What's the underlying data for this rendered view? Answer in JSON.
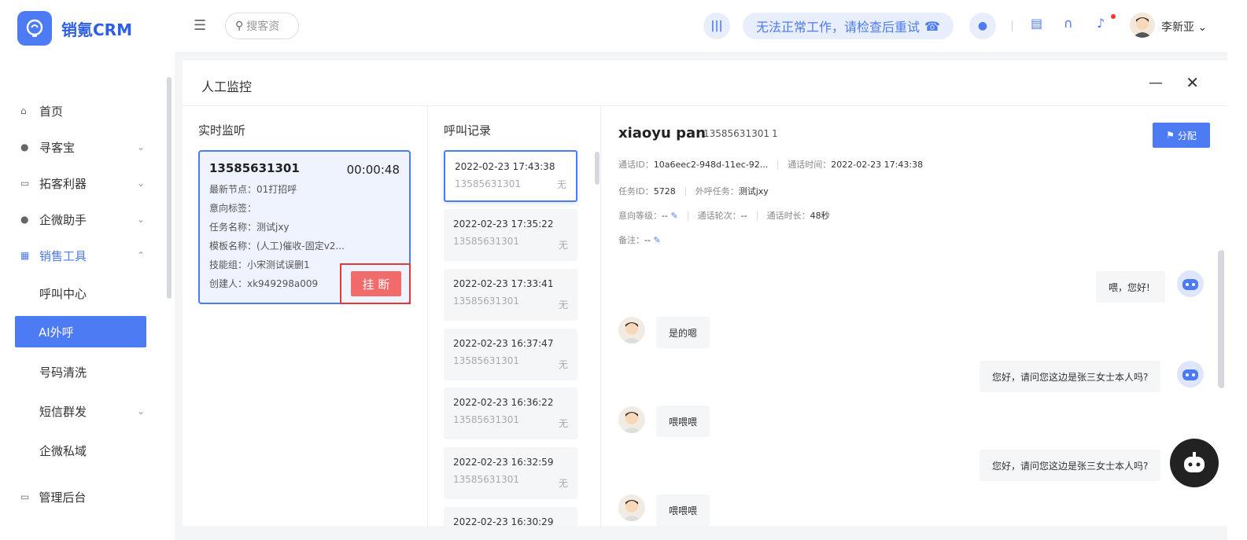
{
  "app": {
    "name": "销氪CRM"
  },
  "sidebar": {
    "items": [
      {
        "label": "首页"
      },
      {
        "label": "寻客宝"
      },
      {
        "label": "拓客利器"
      },
      {
        "label": "企微助手"
      },
      {
        "label": "销售工具"
      }
    ],
    "sub_items": [
      {
        "label": "呼叫中心"
      },
      {
        "label": "AI外呼"
      },
      {
        "label": "号码清洗"
      },
      {
        "label": "短信群发"
      },
      {
        "label": "企微私域"
      }
    ],
    "bottom": {
      "label": "管理后台"
    }
  },
  "topbar": {
    "search_placeholder": "搜客资",
    "status_text": "无法正常工作，请检查后重试",
    "user_name": "李新亚"
  },
  "panel": {
    "title": "人工监控",
    "live": {
      "title": "实时监听",
      "phone": "13585631301",
      "duration": "00:00:48",
      "lines": [
        "最新节点：01打招呼",
        "意向标签：",
        "任务名称：测试jxy",
        "模板名称：(人工)催收-固定v2...",
        "技能组：小宋测试误删1",
        "创建人：xk949298a009"
      ],
      "hangup_label": "挂 断"
    },
    "records": {
      "title": "呼叫记录",
      "items": [
        {
          "datetime": "2022-02-23 17:43:38",
          "phone": "13585631301",
          "status": "无"
        },
        {
          "datetime": "2022-02-23 17:35:22",
          "phone": "13585631301",
          "status": "无"
        },
        {
          "datetime": "2022-02-23 17:33:41",
          "phone": "13585631301",
          "status": "无"
        },
        {
          "datetime": "2022-02-23 16:37:47",
          "phone": "13585631301",
          "status": "无"
        },
        {
          "datetime": "2022-02-23 16:36:22",
          "phone": "13585631301",
          "status": "无"
        },
        {
          "datetime": "2022-02-23 16:32:59",
          "phone": "13585631301",
          "status": "无"
        },
        {
          "datetime": "2022-02-23 16:30:29",
          "phone": "",
          "status": ""
        }
      ]
    },
    "detail": {
      "name": "xiaoyu pan",
      "phone": "13585631301",
      "count": "1",
      "assign_label": "分配",
      "call_id_label": "通话ID：",
      "call_id": "10a6eec2-948d-11ec-92...",
      "call_time_label": "通话时间：",
      "call_time": "2022-02-23 17:43:38",
      "task_id_label": "任务ID：",
      "task_id": "5728",
      "outbound_task_label": "外呼任务：",
      "outbound_task": "测试jxy",
      "intent_label": "意向等级：",
      "intent": "--",
      "rounds_label": "通话轮次：",
      "rounds": "--",
      "duration_label": "通话时长：",
      "duration": "48秒",
      "note_label": "备注：",
      "note": "--",
      "messages": [
        {
          "side": "bot",
          "text": "喂，您好!"
        },
        {
          "side": "user",
          "text": "是的嗯"
        },
        {
          "side": "bot",
          "text": "您好，请问您这边是张三女士本人吗?"
        },
        {
          "side": "user",
          "text": "喂喂喂"
        },
        {
          "side": "bot",
          "text": "您好，请问您这边是张三女士本人吗?"
        },
        {
          "side": "user",
          "text": "喂喂喂"
        }
      ]
    }
  },
  "colors": {
    "accent": "#4d7bf3",
    "danger": "#f26b6b"
  }
}
